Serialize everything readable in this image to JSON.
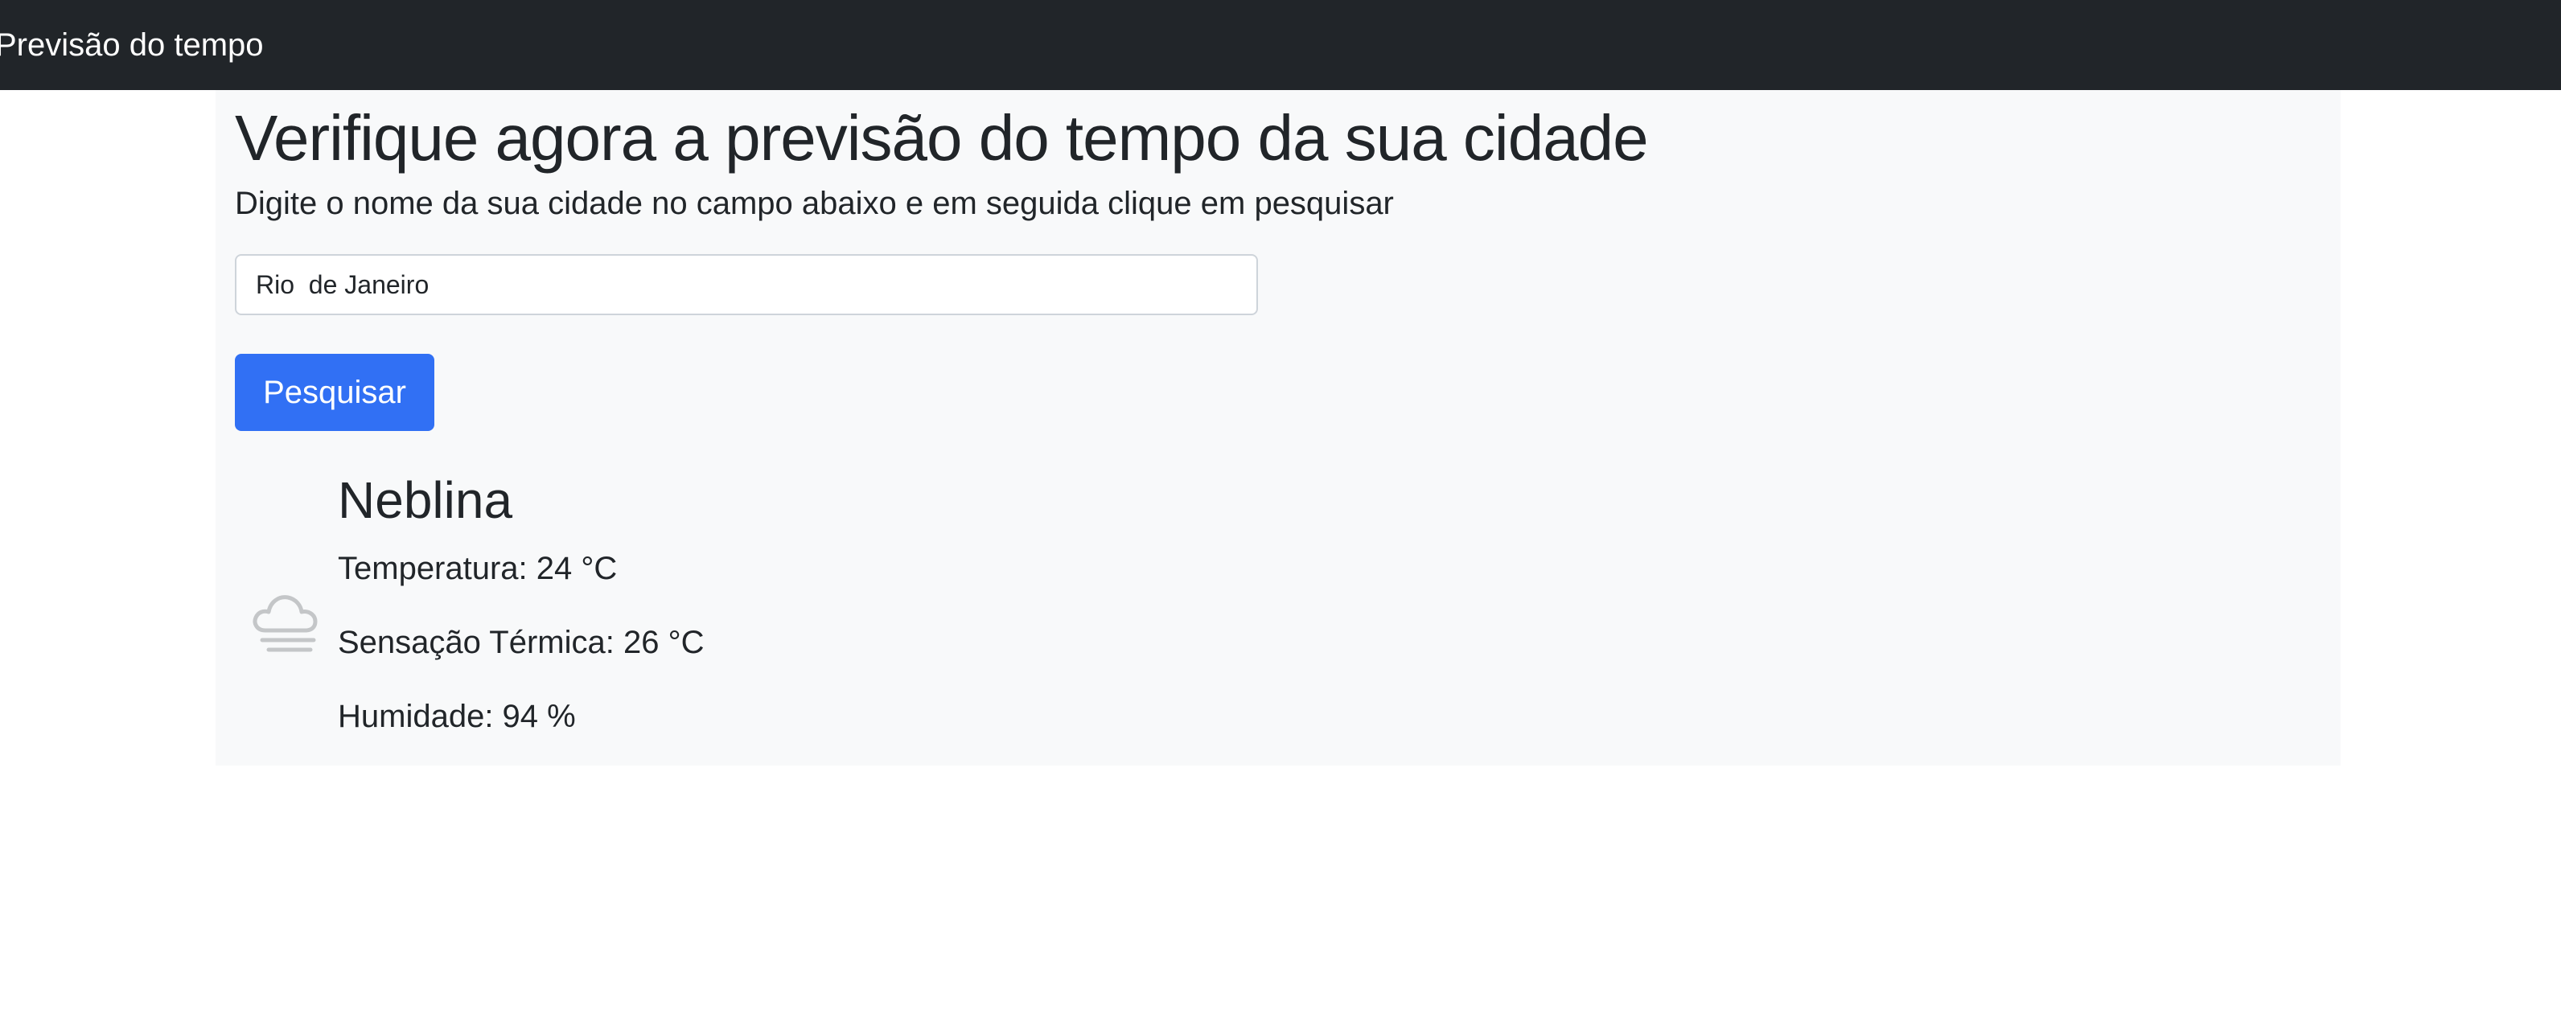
{
  "navbar": {
    "brand": "Previsão do tempo"
  },
  "main": {
    "title": "Verifique agora a previsão do tempo da sua cidade",
    "subtitle": "Digite o nome da sua cidade no campo abaixo e em seguida clique em pesquisar",
    "search": {
      "value": "Rio  de Janeiro",
      "button_label": "Pesquisar"
    },
    "weather": {
      "icon": "cloud-fog-icon",
      "condition": "Neblina",
      "temperature": "Temperatura: 24 °C",
      "feels_like": "Sensação Térmica: 26 °C",
      "humidity": "Humidade: 94 %"
    }
  },
  "colors": {
    "navbar_bg": "#212529",
    "main_bg": "#f8f9fa",
    "button_bg": "#3170f4",
    "icon": "#c4c6c8"
  }
}
